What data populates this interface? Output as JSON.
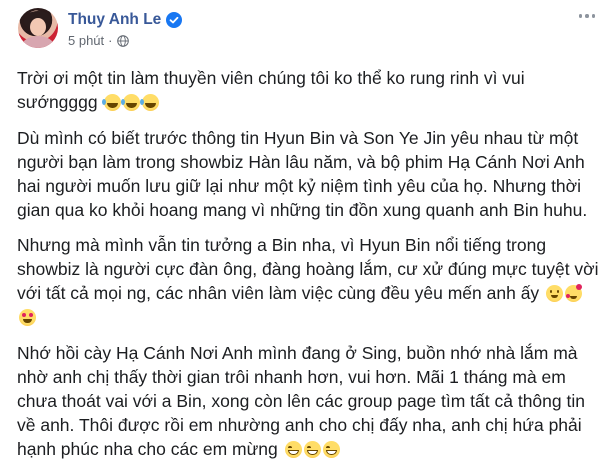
{
  "post": {
    "author": "Thuy Anh Le",
    "time": "5 phút",
    "separator": "·",
    "paragraphs": [
      {
        "text": "Trời ơi một tin làm thuyền viên chúng tôi ko thể ko rung rinh vì vui sướngggg",
        "emojis": [
          "rofl",
          "rofl",
          "rofl"
        ]
      },
      {
        "text": "Dù mình có biết trước thông tin Hyun Bin và Son Ye Jin yêu nhau từ một người bạn làm trong showbiz Hàn lâu năm, và bộ phim Hạ Cánh Nơi Anh hai người muốn lưu giữ lại như một kỷ niệm tình yêu của họ. Nhưng thời gian qua ko khỏi hoang mang vì những tin đồn xung quanh anh Bin huhu.",
        "emojis": []
      },
      {
        "text": "Nhưng mà mình vẫn tin tưởng a Bin nha, vì Hyun Bin nổi tiếng trong showbiz là người cực đàn ông, đàng hoàng lắm, cư xử đúng mực tuyệt vời với tất cả mọi ng, các nhân viên làm việc cùng đều yêu mến anh ấy",
        "emojis": [
          "wink",
          "love",
          "hearteyes"
        ]
      },
      {
        "text": "Nhớ hồi cày Hạ Cánh Nơi Anh mình đang ở Sing, buồn nhớ nhà lắm mà nhờ anh chị thấy thời gian trôi nhanh hơn, vui hơn. Mãi 1 tháng mà em chưa thoát vai với a Bin, xong còn lên các group page tìm tất cả thông tin về anh. Thôi được rồi em nhường anh cho chị đấy nha, anh chị hứa phải hạnh phúc nha cho các em mừng",
        "emojis": [
          "grin",
          "grin",
          "grin"
        ]
      }
    ]
  },
  "icons": {
    "verified": "verified-badge-icon",
    "globe": "globe-icon",
    "more": "more-options-icon"
  },
  "colors": {
    "author": "#385898",
    "meta": "#616770",
    "text": "#1c1e21",
    "verified": "#1877f2"
  }
}
